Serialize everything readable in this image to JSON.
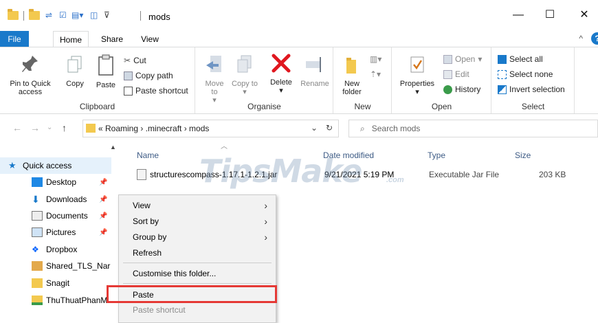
{
  "window": {
    "title": "mods",
    "minimize": "—",
    "maximize": "☐",
    "close": "✕"
  },
  "tabs": {
    "file": "File",
    "home": "Home",
    "share": "Share",
    "view": "View",
    "collapse": "^",
    "help": "?"
  },
  "ribbon": {
    "clipboard": {
      "label": "Clipboard",
      "pin": "Pin to Quick access",
      "copy": "Copy",
      "paste": "Paste",
      "cut": "Cut",
      "copy_path": "Copy path",
      "paste_shortcut": "Paste shortcut"
    },
    "organise": {
      "label": "Organise",
      "move_to": "Move to",
      "copy_to": "Copy to",
      "delete": "Delete",
      "rename": "Rename"
    },
    "new": {
      "label": "New",
      "new_folder": "New folder"
    },
    "open": {
      "label": "Open",
      "properties": "Properties",
      "open": "Open",
      "edit": "Edit",
      "history": "History"
    },
    "select": {
      "label": "Select",
      "select_all": "Select all",
      "select_none": "Select none",
      "invert": "Invert selection"
    }
  },
  "address": {
    "crumbs": "« Roaming › .minecraft › mods",
    "search_placeholder": "Search mods"
  },
  "nav": {
    "items": [
      {
        "label": "Quick access"
      },
      {
        "label": "Desktop"
      },
      {
        "label": "Downloads"
      },
      {
        "label": "Documents"
      },
      {
        "label": "Pictures"
      },
      {
        "label": "Dropbox"
      },
      {
        "label": "Shared_TLS_Nar"
      },
      {
        "label": "Snagit"
      },
      {
        "label": "ThuThuatPhanM"
      }
    ]
  },
  "columns": {
    "name": "Name",
    "date": "Date modified",
    "type": "Type",
    "size": "Size"
  },
  "files": [
    {
      "name": "structurescompass-1.17.1-1.2.1.jar",
      "date": "9/21/2021 5:19 PM",
      "type": "Executable Jar File",
      "size": "203 KB"
    }
  ],
  "watermark": {
    "text": "TipsMake",
    "sub": ".com"
  },
  "context_menu": {
    "view": "View",
    "sort_by": "Sort by",
    "group_by": "Group by",
    "refresh": "Refresh",
    "customise": "Customise this folder...",
    "paste": "Paste",
    "paste_shortcut": "Paste shortcut"
  },
  "colors": {
    "accent": "#1979ca",
    "highlight": "#e53935",
    "folder": "#f3c94f"
  }
}
